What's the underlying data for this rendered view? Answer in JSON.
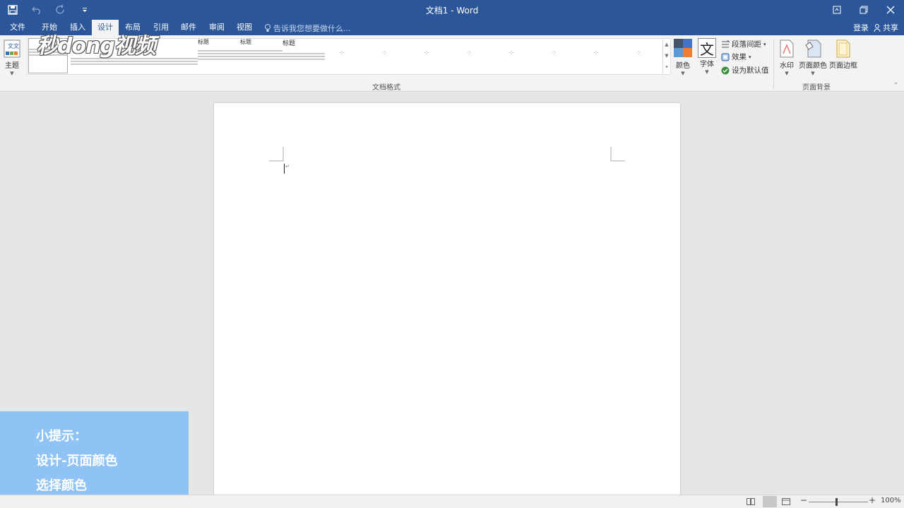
{
  "titlebar": {
    "title": "文档1 - Word",
    "qat": {
      "save_icon": "save-icon",
      "undo_icon": "undo-icon",
      "redo_icon": "redo-icon",
      "customize_icon": "customize-qat-icon"
    },
    "window_controls": {
      "ribbon_display_icon": "ribbon-display-icon",
      "restore_icon": "restore-icon",
      "close_icon": "close-icon"
    }
  },
  "tabs": {
    "items": [
      {
        "label": "文件"
      },
      {
        "label": "开始"
      },
      {
        "label": "插入"
      },
      {
        "label": "设计"
      },
      {
        "label": "布局"
      },
      {
        "label": "引用"
      },
      {
        "label": "邮件"
      },
      {
        "label": "审阅"
      },
      {
        "label": "视图"
      }
    ],
    "active_index": 3,
    "tellme_placeholder": "告诉我您想要做什么...",
    "login": "登录",
    "share": "共享"
  },
  "ribbon": {
    "theme": {
      "label": "主题"
    },
    "doc_format": {
      "group_label": "文档格式",
      "styles": [
        {
          "heading": "标题"
        },
        {
          "heading": "标题"
        },
        {
          "heading": "标题"
        }
      ]
    },
    "colors": {
      "label": "颜色"
    },
    "fonts": {
      "label": "字体",
      "glyph": "文"
    },
    "paragraph_spacing": {
      "label": "段落间距"
    },
    "effects": {
      "label": "效果"
    },
    "set_default": {
      "label": "设为默认值"
    },
    "page_background": {
      "group_label": "页面背景",
      "watermark": "水印",
      "page_color": "页面颜色",
      "page_borders": "页面边框"
    }
  },
  "brand_watermark": "秒dong视频",
  "tip": {
    "line1": "小提示：",
    "line2": "设计-页面颜色",
    "line3": "选择颜色"
  },
  "statusbar": {
    "zoom": "100%"
  },
  "colors": {
    "accent": "#2b579a",
    "tip_bg": "#8fc3f5"
  }
}
